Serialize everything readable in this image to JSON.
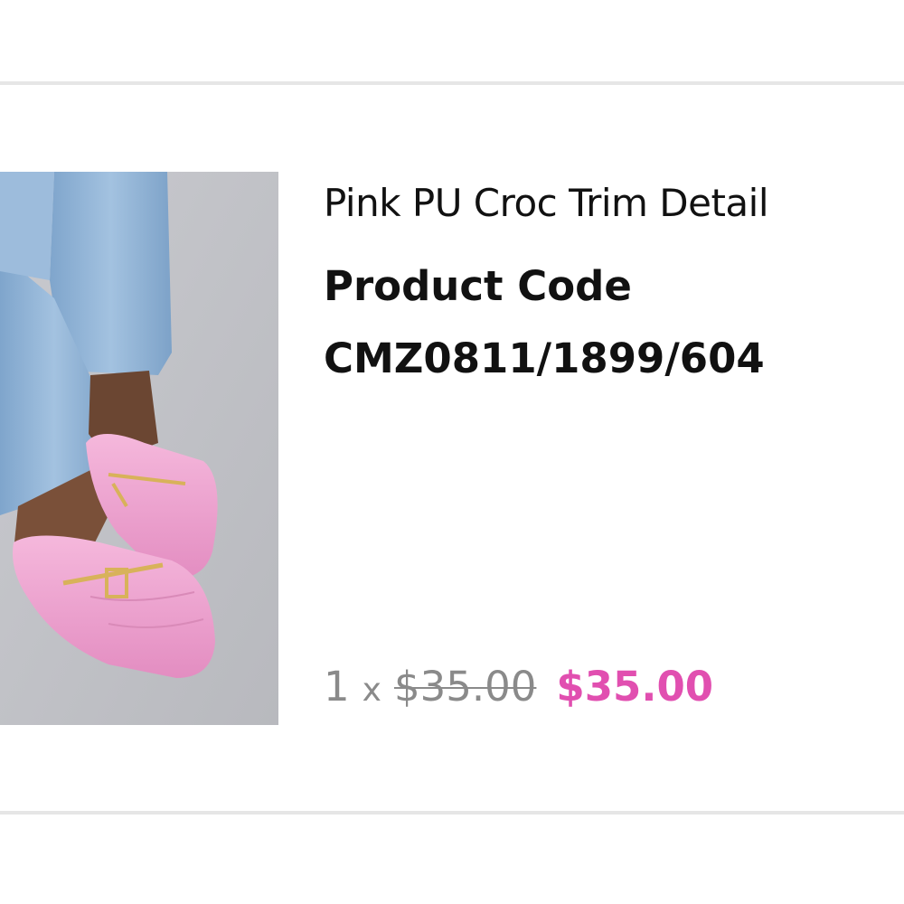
{
  "product": {
    "title": "Pink PU Croc Trim Detail",
    "code_label": "Product Code",
    "code_value": "CMZ0811/1899/604",
    "image_icon": "product-photo-pink-loafer-mules"
  },
  "pricing": {
    "quantity": "1",
    "multiplier": "x",
    "original_price": "$35.00",
    "sale_price": "$35.00",
    "sale_color": "#e14fb0"
  },
  "colors": {
    "text_primary": "#111111",
    "text_muted": "#8a8a8a",
    "divider": "#e6e6e6",
    "shoe_pink": "#f0a8d4",
    "denim": "#8fb3d6"
  }
}
